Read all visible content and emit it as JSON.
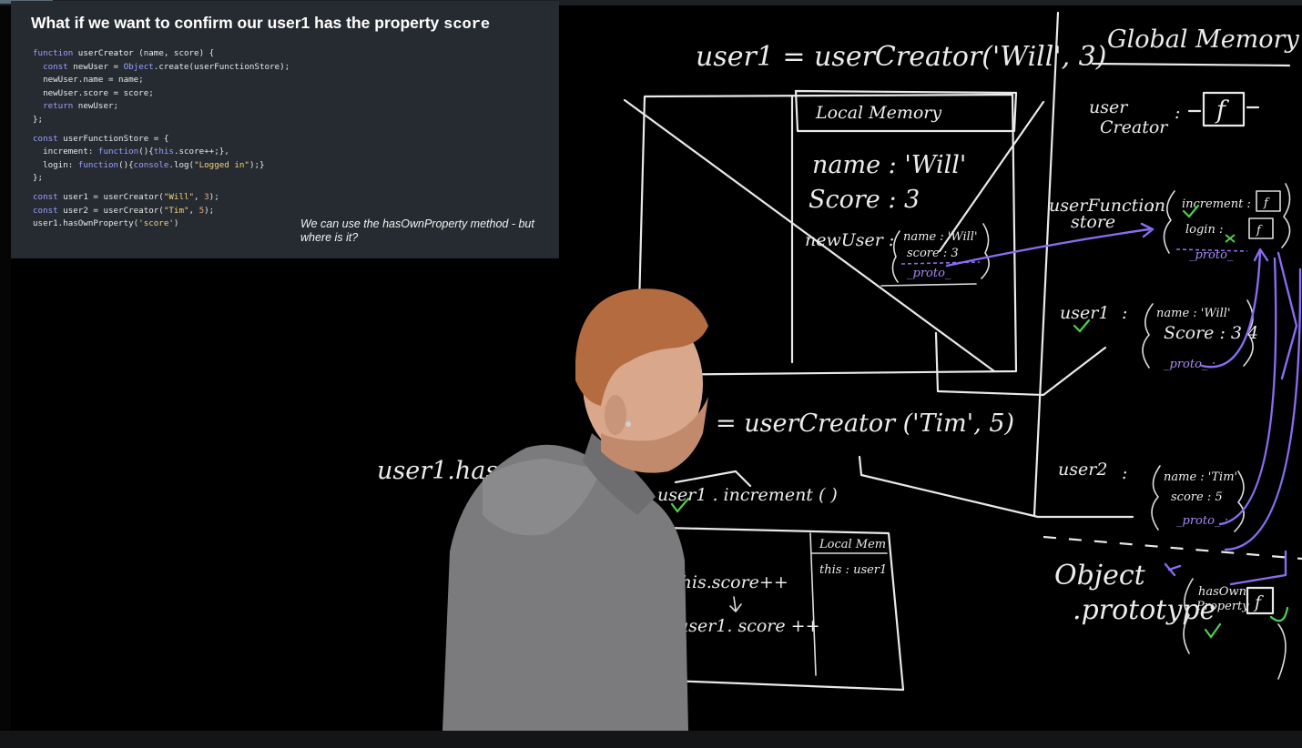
{
  "slide": {
    "title_prefix": "What if we want to confirm our user1 has the property ",
    "title_code": "score",
    "code_lines": [
      {
        "parts": [
          {
            "t": "function ",
            "c": "kw"
          },
          {
            "t": "userCreator",
            "c": "fn"
          },
          {
            "t": " (name, score) {",
            "c": ""
          }
        ]
      },
      {
        "parts": [
          {
            "t": "  const ",
            "c": "kw"
          },
          {
            "t": "newUser = ",
            "c": ""
          },
          {
            "t": "Object",
            "c": "obj"
          },
          {
            "t": ".create(userFunctionStore);",
            "c": ""
          }
        ]
      },
      {
        "parts": [
          {
            "t": "  newUser.name = name;",
            "c": ""
          }
        ]
      },
      {
        "parts": [
          {
            "t": "  newUser.score = score;",
            "c": ""
          }
        ]
      },
      {
        "parts": [
          {
            "t": "  return ",
            "c": "kw"
          },
          {
            "t": "newUser;",
            "c": ""
          }
        ]
      },
      {
        "parts": [
          {
            "t": "};",
            "c": ""
          }
        ]
      },
      {
        "gap": true
      },
      {
        "parts": [
          {
            "t": "const ",
            "c": "kw"
          },
          {
            "t": "userFunctionStore = {",
            "c": ""
          }
        ]
      },
      {
        "parts": [
          {
            "t": "  increment: ",
            "c": ""
          },
          {
            "t": "function",
            "c": "kw"
          },
          {
            "t": "(){",
            "c": ""
          },
          {
            "t": "this",
            "c": "kw"
          },
          {
            "t": ".score++;},",
            "c": ""
          }
        ]
      },
      {
        "parts": [
          {
            "t": "  login: ",
            "c": ""
          },
          {
            "t": "function",
            "c": "kw"
          },
          {
            "t": "(){",
            "c": ""
          },
          {
            "t": "console",
            "c": "kw"
          },
          {
            "t": ".log(",
            "c": ""
          },
          {
            "t": "\"Logged in\"",
            "c": "str"
          },
          {
            "t": ");}",
            "c": ""
          }
        ]
      },
      {
        "parts": [
          {
            "t": "};",
            "c": ""
          }
        ]
      },
      {
        "gap": true
      },
      {
        "parts": [
          {
            "t": "const ",
            "c": "kw"
          },
          {
            "t": "user1 = userCreator(",
            "c": ""
          },
          {
            "t": "\"Will\"",
            "c": "str"
          },
          {
            "t": ", ",
            "c": ""
          },
          {
            "t": "3",
            "c": "num"
          },
          {
            "t": ");",
            "c": ""
          }
        ]
      },
      {
        "parts": [
          {
            "t": "const ",
            "c": "kw"
          },
          {
            "t": "user2 = userCreator(",
            "c": ""
          },
          {
            "t": "\"Tim\"",
            "c": "str"
          },
          {
            "t": ", ",
            "c": ""
          },
          {
            "t": "5",
            "c": "num"
          },
          {
            "t": ");",
            "c": ""
          }
        ]
      },
      {
        "parts": [
          {
            "t": "user1.hasOwnProperty(",
            "c": ""
          },
          {
            "t": "'score'",
            "c": "str"
          },
          {
            "t": ")",
            "c": ""
          }
        ]
      }
    ],
    "note": "We can use the hasOwnProperty method - but where is it?"
  },
  "board": {
    "call_user1": "user1 = userCreator('Will', 3)",
    "global_memory": "Global Memory",
    "local_memory": "Local Memory",
    "lm_name": "name : 'Will'",
    "lm_score": "Score : 3",
    "lm_newuser": "newUser :",
    "lm_obj_name": "name : 'Will'",
    "lm_obj_score": "score : 3",
    "lm_obj_proto": "_proto_",
    "gm_usercreator_1": "user",
    "gm_usercreator_2": "Creator",
    "gm_f": "f",
    "gm_store_1": "userFunction",
    "gm_store_2": "store",
    "gm_increment": "increment :",
    "gm_login": "login :",
    "gm_proto": "_proto_",
    "gm_user1": "user1",
    "gm_user1_name": "name : 'Will'",
    "gm_user1_score": "Score : 3 4",
    "gm_user1_proto": "_proto_ :",
    "call_user2": "= userCreator ('Tim', 5)",
    "gm_user2": "user2",
    "gm_user2_name": "name : 'Tim'",
    "gm_user2_score": "score : 5",
    "gm_user2_proto": "_proto_ :",
    "has_own": "user1.hasOwnProp",
    "increment_call": "user1 . increment ( )",
    "lm2_header": "Local Mem",
    "lm2_this": "this : user1",
    "body_line1": "this.score++",
    "body_line2": "user1. score ++",
    "object_proto_1": "Object",
    "object_proto_2": ".prototype",
    "op_hasown_1": "hasOwn",
    "op_hasown_2": "Property"
  }
}
